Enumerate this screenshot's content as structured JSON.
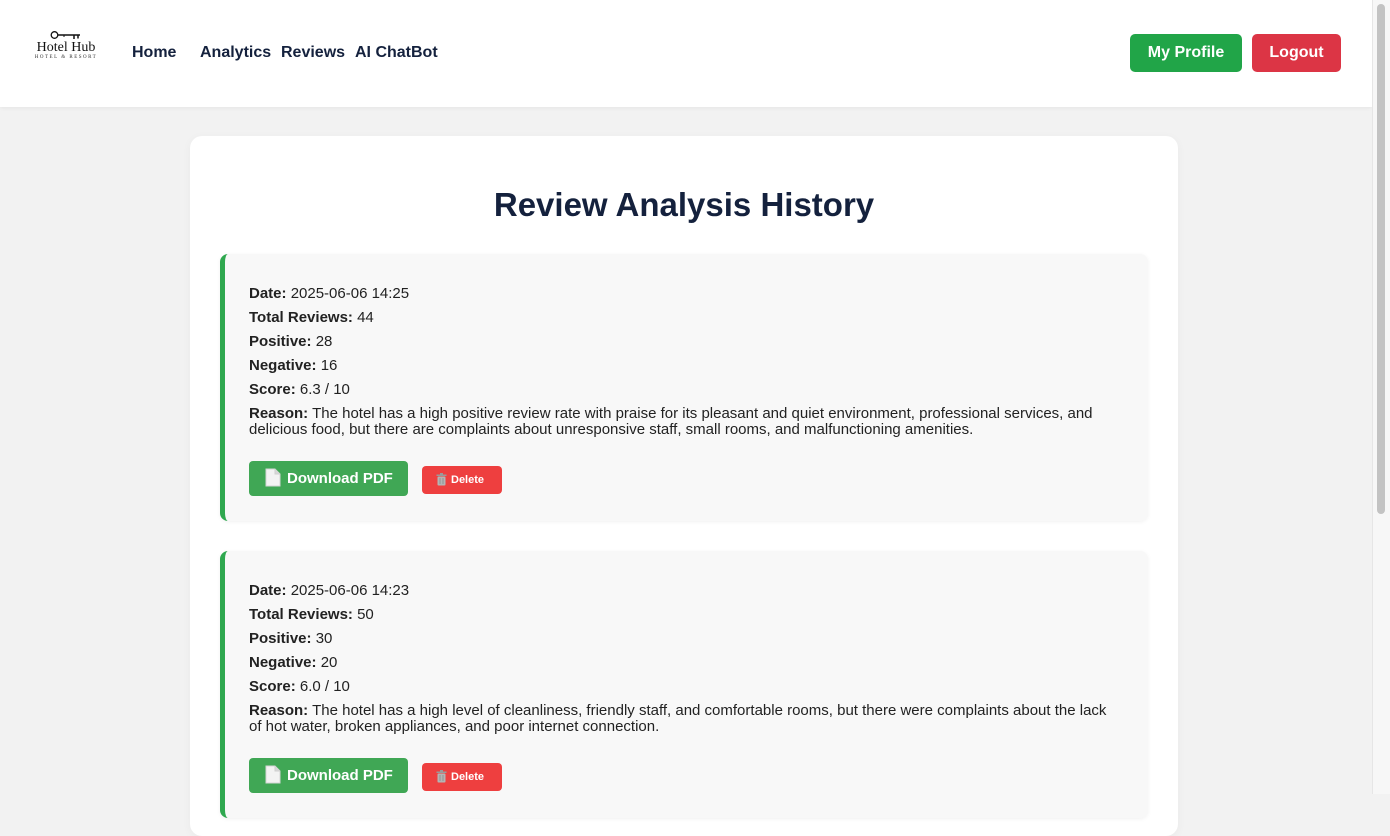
{
  "header": {
    "logo": {
      "brand": "Hotel Hub",
      "tagline": "HOTEL & RESORT",
      "icon": "key-icon"
    },
    "nav": [
      {
        "label": "Home"
      },
      {
        "label": "Analytics"
      },
      {
        "label": "Reviews"
      },
      {
        "label": "AI ChatBot"
      }
    ],
    "profile_label": "My Profile",
    "logout_label": "Logout"
  },
  "page": {
    "title": "Review Analysis History"
  },
  "labels": {
    "date": "Date:",
    "total": "Total Reviews:",
    "positive": "Positive:",
    "negative": "Negative:",
    "score": "Score:",
    "reason": "Reason:",
    "download": "Download PDF",
    "delete": "Delete"
  },
  "history": [
    {
      "date": "2025-06-06 14:25",
      "total": "44",
      "positive": "28",
      "negative": "16",
      "score": "6.3 / 10",
      "reason": "The hotel has a high positive review rate with praise for its pleasant and quiet environment, professional services, and delicious food, but there are complaints about unresponsive staff, small rooms, and malfunctioning amenities."
    },
    {
      "date": "2025-06-06 14:23",
      "total": "50",
      "positive": "30",
      "negative": "20",
      "score": "6.0 / 10",
      "reason": "The hotel has a high level of cleanliness, friendly staff, and comfortable rooms, but there were complaints about the lack of hot water, broken appliances, and poor internet connection."
    }
  ],
  "colors": {
    "navy": "#14213d",
    "green": "#21a548",
    "red": "#dc3545",
    "card_border": "#2fa84f",
    "pdf_button": "#40a755",
    "delete_button": "#ee3f3f"
  }
}
